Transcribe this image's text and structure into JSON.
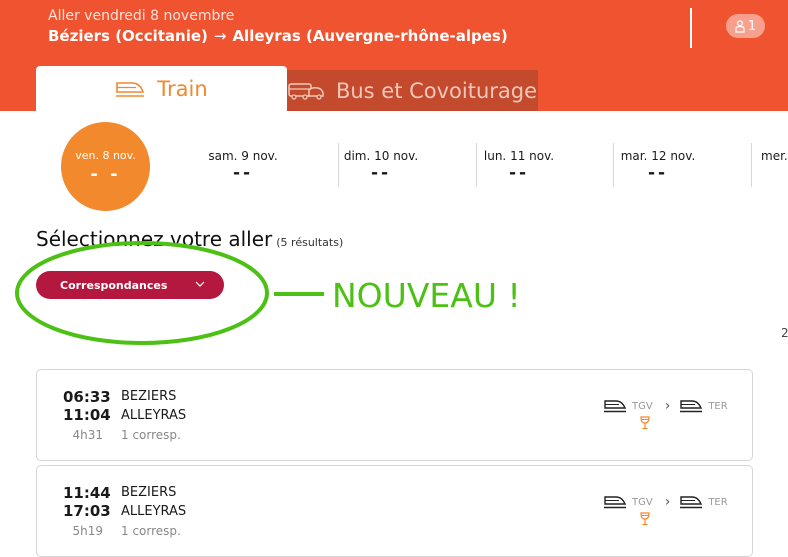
{
  "header": {
    "date_line": "Aller vendredi 8 novembre",
    "origin": "Béziers (Occitanie)",
    "arrow": "→",
    "destination": "Alleyras (Auvergne-rhône-alpes)",
    "passengers": "1"
  },
  "tabs": [
    {
      "label": "Train",
      "icon": "train-icon",
      "active": true
    },
    {
      "label": "Bus et Covoiturage",
      "icon": "bus-car-icon",
      "active": false
    }
  ],
  "dates": [
    {
      "label": "ven. 8 nov.",
      "price": "- -",
      "selected": true
    },
    {
      "label": "sam. 9 nov.",
      "price": "--"
    },
    {
      "label": "dim. 10 nov.",
      "price": "--"
    },
    {
      "label": "lun. 11 nov.",
      "price": "--"
    },
    {
      "label": "mar. 12 nov.",
      "price": "--"
    },
    {
      "label": "mer."
    }
  ],
  "results": {
    "title": "Sélectionnez votre aller",
    "count": "(5 résultats)",
    "filter_label": "Correspondances"
  },
  "annotation": {
    "text": "NOUVEAU !"
  },
  "edge_number": "2",
  "journeys": [
    {
      "dep": "06:33",
      "arr": "11:04",
      "duration": "4h31",
      "from": "BEZIERS",
      "to": "ALLEYRAS",
      "connections": "1 corresp.",
      "legs": [
        "TGV",
        "TER"
      ]
    },
    {
      "dep": "11:44",
      "arr": "17:03",
      "duration": "5h19",
      "from": "BEZIERS",
      "to": "ALLEYRAS",
      "connections": "1 corresp.",
      "legs": [
        "TGV",
        "TER"
      ]
    }
  ],
  "colors": {
    "header_bg": "#f0532f",
    "accent_orange": "#f2892c",
    "filter_bg": "#b5183f",
    "annotation_green": "#4cc114"
  }
}
